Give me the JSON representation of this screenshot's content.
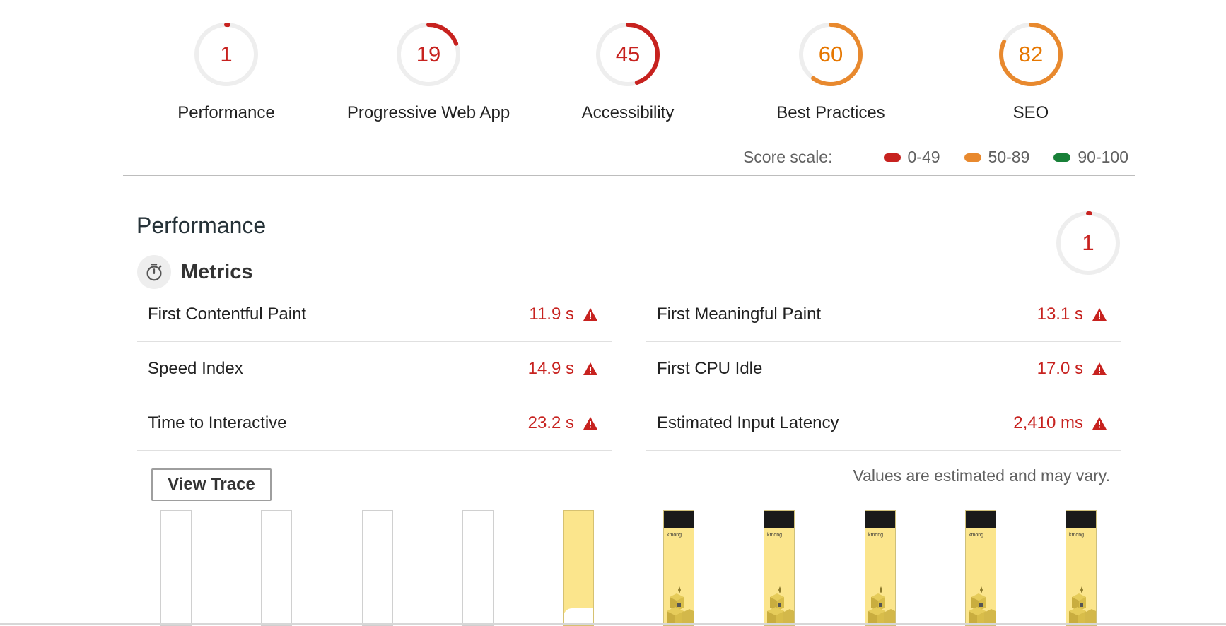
{
  "colors": {
    "fail": "#c7221f",
    "average": "#e67700",
    "average_ring": "#e8892e",
    "pass": "#188038",
    "track": "#eeeeee"
  },
  "categories": [
    {
      "name": "Performance",
      "score": 1,
      "rating": "fail"
    },
    {
      "name": "Progressive Web App",
      "score": 19,
      "rating": "fail"
    },
    {
      "name": "Accessibility",
      "score": 45,
      "rating": "fail"
    },
    {
      "name": "Best Practices",
      "score": 60,
      "rating": "average"
    },
    {
      "name": "SEO",
      "score": 82,
      "rating": "average"
    }
  ],
  "score_scale": {
    "title": "Score scale:",
    "ranges": [
      {
        "label": "0-49",
        "color": "#c7221f"
      },
      {
        "label": "50-89",
        "color": "#e8892e"
      },
      {
        "label": "90-100",
        "color": "#188038"
      }
    ]
  },
  "performance": {
    "title": "Performance",
    "score": 1,
    "metrics_title": "Metrics",
    "metrics_icon": "stopwatch-icon",
    "warning_icon": "warning-triangle-icon",
    "metrics_left": [
      {
        "name": "First Contentful Paint",
        "value": "11.9 s"
      },
      {
        "name": "Speed Index",
        "value": "14.9 s"
      },
      {
        "name": "Time to Interactive",
        "value": "23.2 s"
      }
    ],
    "metrics_right": [
      {
        "name": "First Meaningful Paint",
        "value": "13.1 s"
      },
      {
        "name": "First CPU Idle",
        "value": "17.0 s"
      },
      {
        "name": "Estimated Input Latency",
        "value": "2,410 ms"
      }
    ],
    "view_trace_label": "View Trace",
    "estimate_note": "Values are estimated and may vary.",
    "filmstrip": {
      "frame_states": [
        "blank",
        "blank",
        "blank",
        "blank",
        "partial",
        "full",
        "full",
        "full",
        "full",
        "full"
      ],
      "brand_text": "kmong"
    }
  }
}
